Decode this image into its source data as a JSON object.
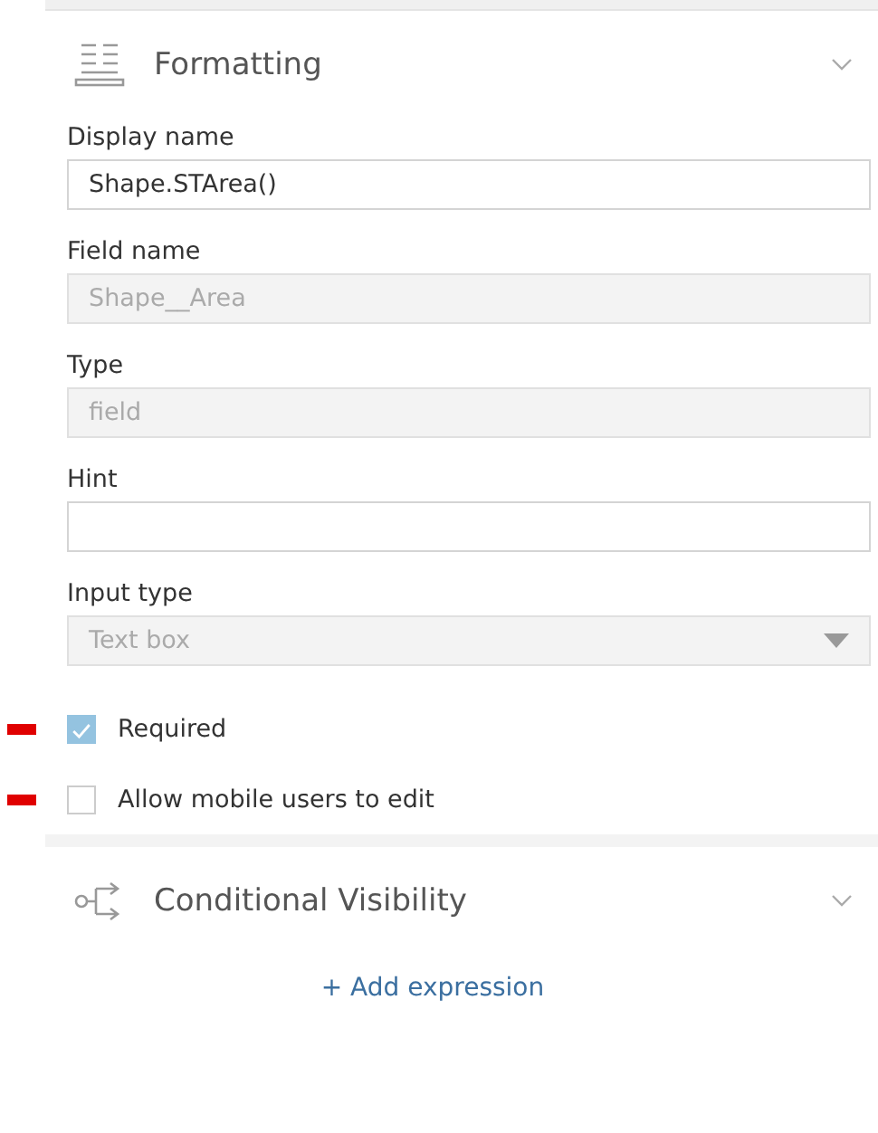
{
  "sections": [
    {
      "title": "Formatting",
      "expanded": true
    },
    {
      "title": "Conditional Visibility",
      "expanded": true
    }
  ],
  "fields": [
    {
      "label": "Display name",
      "kind": "text",
      "value": "Shape.STArea()",
      "disabled": false
    },
    {
      "label": "Field name",
      "kind": "text",
      "value": "Shape__Area",
      "disabled": true
    },
    {
      "label": "Type",
      "kind": "text",
      "value": "field",
      "disabled": true
    },
    {
      "label": "Hint",
      "kind": "text",
      "disabled": false
    },
    {
      "label": "Input type",
      "kind": "select",
      "value": "Text box",
      "disabled": true
    }
  ],
  "checkboxes": [
    {
      "label": "Required",
      "checked": true
    },
    {
      "label": "Allow mobile users to edit",
      "checked": false
    }
  ],
  "link": "+ Add expression"
}
